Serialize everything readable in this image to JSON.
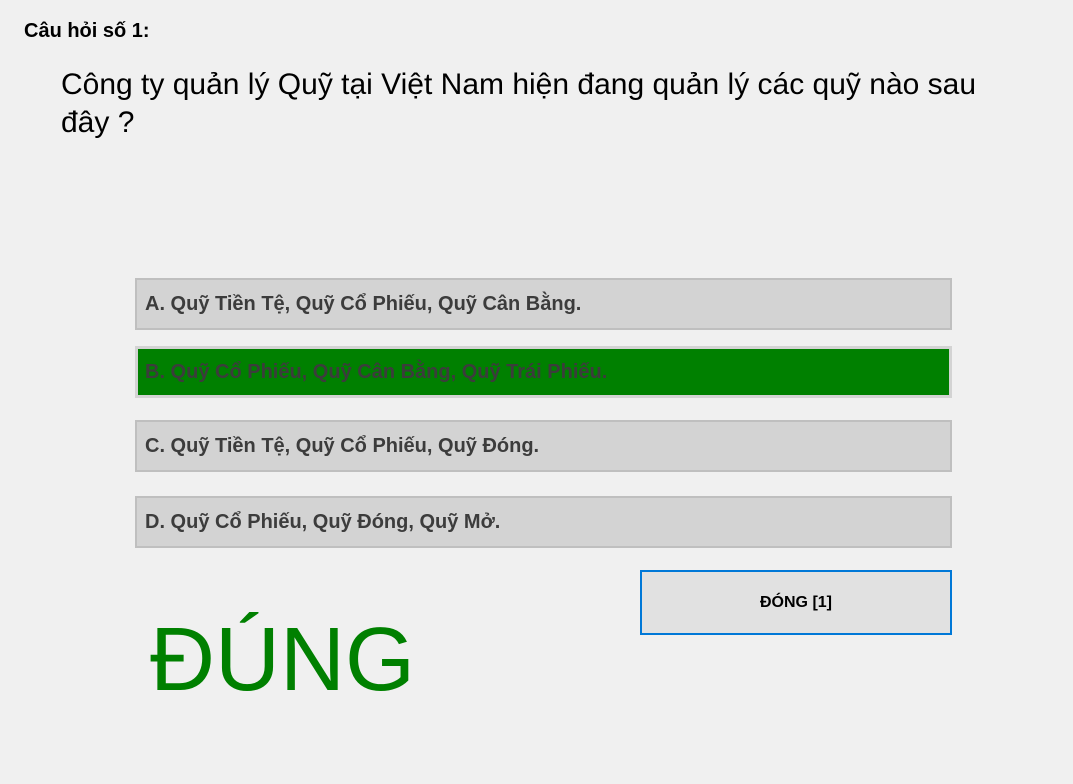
{
  "question": {
    "number_label": "Câu hỏi số 1:",
    "text": "Công ty quản lý Quỹ tại Việt Nam hiện đang quản lý các quỹ nào sau đây ?"
  },
  "answers": [
    {
      "label": "A. Quỹ Tiền Tệ, Quỹ Cổ Phiếu, Quỹ Cân Bằng.",
      "selected": false
    },
    {
      "label": "B. Quỹ Cổ Phiếu, Quỹ Cân Bằng, Quỹ Trái Phiếu.",
      "selected": true
    },
    {
      "label": "C. Quỹ Tiền Tệ, Quỹ Cổ Phiếu, Quỹ Đóng.",
      "selected": false
    },
    {
      "label": "D. Quỹ Cổ Phiếu, Quỹ Đóng, Quỹ Mở.",
      "selected": false
    }
  ],
  "close_button": {
    "label": "ĐÓNG [1]"
  },
  "result": {
    "text": "ĐÚNG"
  },
  "colors": {
    "correct": "#008000",
    "answer_bg": "#d3d3d3",
    "button_border": "#0078d7"
  }
}
